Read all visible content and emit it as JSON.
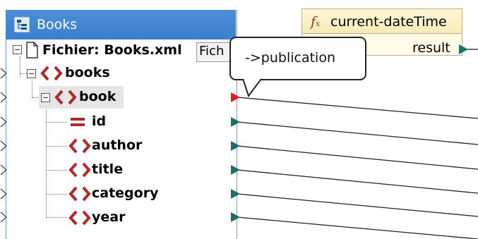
{
  "source_component": {
    "title": "Books",
    "file_row": {
      "label": "Fichier: Books.xml",
      "button": "Fich"
    },
    "tree": [
      {
        "label": "books",
        "type": "element"
      },
      {
        "label": "book",
        "type": "element",
        "selected": true
      },
      {
        "label": "id",
        "type": "attribute"
      },
      {
        "label": "author",
        "type": "element"
      },
      {
        "label": "title",
        "type": "element"
      },
      {
        "label": "category",
        "type": "element"
      },
      {
        "label": "year",
        "type": "element"
      }
    ]
  },
  "function_component": {
    "icon": "fx-icon",
    "name": "current-dateTime",
    "output": "result"
  },
  "tooltip": {
    "text": "->publication"
  },
  "colors": {
    "header_blue": "#3c7fcd",
    "element_icon_red": "#b0282b",
    "connector_teal": "#1d6f6a",
    "selected_connector_red": "#e02020",
    "function_header": "#f6ebb8"
  }
}
